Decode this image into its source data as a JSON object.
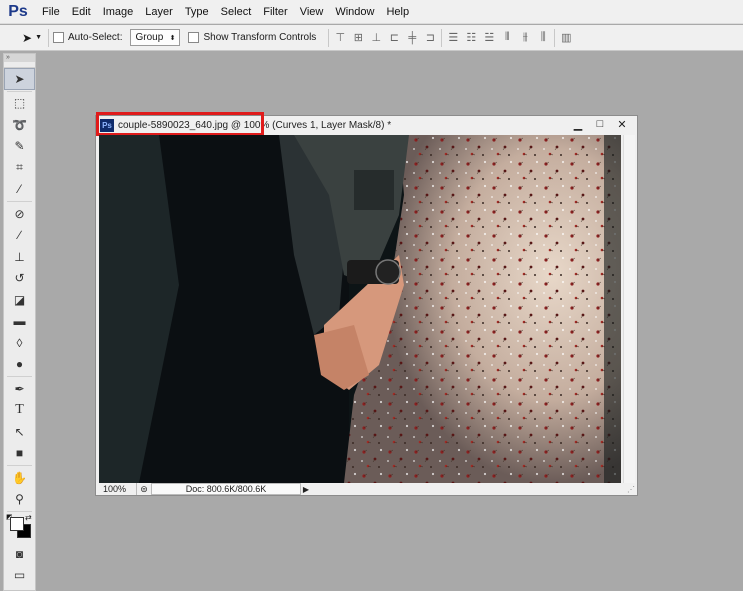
{
  "app": {
    "logo": "Ps"
  },
  "menu": [
    "File",
    "Edit",
    "Image",
    "Layer",
    "Type",
    "Select",
    "Filter",
    "View",
    "Window",
    "Help"
  ],
  "options": {
    "tool_icon": "move-tool-icon",
    "auto_select_label": "Auto-Select:",
    "auto_select_checked": false,
    "group_value": "Group",
    "show_transform_label": "Show Transform Controls",
    "show_transform_checked": false
  },
  "tools": {
    "header": "»",
    "items": [
      "move-tool-icon",
      "rectangular-marquee-icon",
      "lasso-icon",
      "quick-selection-icon",
      "crop-icon",
      "eyedropper-icon",
      "spot-healing-icon",
      "brush-icon",
      "clone-stamp-icon",
      "history-brush-icon",
      "eraser-icon",
      "gradient-icon",
      "blur-icon",
      "dodge-icon",
      "pen-icon",
      "type-icon",
      "path-selection-icon",
      "rectangle-icon",
      "hand-icon",
      "zoom-icon"
    ]
  },
  "document": {
    "title": "couple-5890023_640.jpg @ 100% (Curves 1, Layer Mask/8) *",
    "zoom": "100%",
    "doc_info": "Doc: 800.6K/800.6K"
  }
}
